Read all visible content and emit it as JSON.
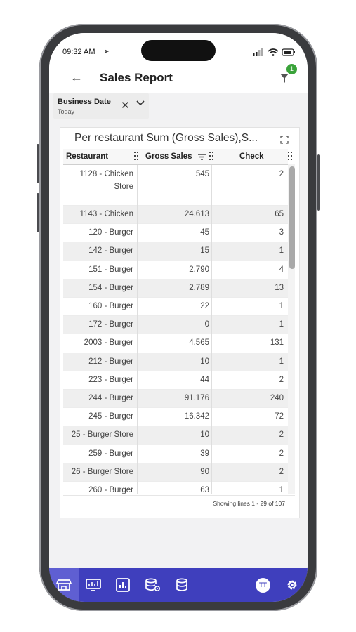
{
  "status_bar": {
    "time": "09:32 AM"
  },
  "header": {
    "title": "Sales Report",
    "back": "←",
    "filter_badge": "1"
  },
  "filter_chip": {
    "label": "Business Date",
    "value": "Today",
    "clear": "✕"
  },
  "report": {
    "title": "Per restaurant Sum (Gross Sales),S...",
    "columns": [
      "Restaurant",
      "Gross Sales",
      "Check"
    ],
    "rows": [
      {
        "restaurant": "1128 - Chicken Store",
        "gross_sales": "545",
        "check": "2"
      },
      {
        "restaurant": "1143 - Chicken",
        "gross_sales": "24.613",
        "check": "65"
      },
      {
        "restaurant": "120 - Burger",
        "gross_sales": "45",
        "check": "3"
      },
      {
        "restaurant": "142 - Burger",
        "gross_sales": "15",
        "check": "1"
      },
      {
        "restaurant": "151 - Burger",
        "gross_sales": "2.790",
        "check": "4"
      },
      {
        "restaurant": "154 - Burger",
        "gross_sales": "2.789",
        "check": "13"
      },
      {
        "restaurant": "160 - Burger",
        "gross_sales": "22",
        "check": "1"
      },
      {
        "restaurant": "172 - Burger",
        "gross_sales": "0",
        "check": "1"
      },
      {
        "restaurant": "2003 - Burger",
        "gross_sales": "4.565",
        "check": "131"
      },
      {
        "restaurant": "212 - Burger",
        "gross_sales": "10",
        "check": "1"
      },
      {
        "restaurant": "223 - Burger",
        "gross_sales": "44",
        "check": "2"
      },
      {
        "restaurant": "244 - Burger",
        "gross_sales": "91.176",
        "check": "240"
      },
      {
        "restaurant": "245 - Burger",
        "gross_sales": "16.342",
        "check": "72"
      },
      {
        "restaurant": "25 - Burger Store",
        "gross_sales": "10",
        "check": "2"
      },
      {
        "restaurant": "259 - Burger",
        "gross_sales": "39",
        "check": "2"
      },
      {
        "restaurant": "26 - Burger Store",
        "gross_sales": "90",
        "check": "2"
      },
      {
        "restaurant": "260 - Burger",
        "gross_sales": "63",
        "check": "1"
      }
    ],
    "footer": "Showing lines 1 - 29 of 107"
  },
  "tabbar": {
    "items": [
      {
        "icon": "store-icon",
        "active": true
      },
      {
        "icon": "monitor-chart-icon",
        "active": false
      },
      {
        "icon": "bar-chart-icon",
        "active": false
      },
      {
        "icon": "database-settings-icon",
        "active": false
      },
      {
        "icon": "database-icon",
        "active": false
      }
    ],
    "avatar_initials": "TT",
    "settings_icon": "gear-icon"
  },
  "colors": {
    "tabbar": "#3f3fbd",
    "tab_active": "#5f5fd2",
    "badge": "#3aa33a"
  }
}
